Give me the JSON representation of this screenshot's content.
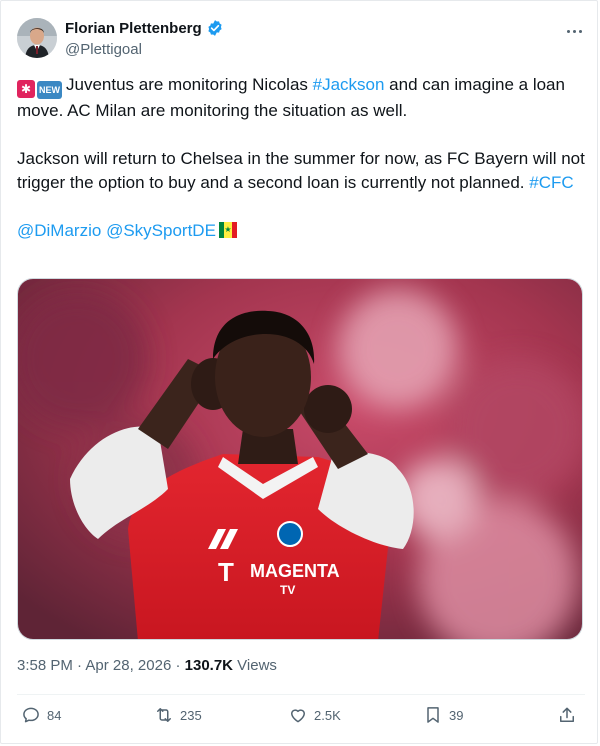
{
  "author": {
    "name": "Florian Plettenberg",
    "handle": "@Plettigoal",
    "verified": true
  },
  "tweet": {
    "line1_prefix": "Juventus are monitoring Nicolas ",
    "hashtag_jackson": "#Jackson",
    "line1_suffix": " and can imagine a loan move. AC Milan are monitoring the situation as well.",
    "para2": "Jackson will return to Chelsea in the summer for now, as FC Bayern will not trigger the option to buy and a second loan is currently not planned. ",
    "hashtag_cfc": "#CFC",
    "mention1": "@DiMarzio",
    "mention2": "@SkySportDE",
    "badge_new": "NEW"
  },
  "media": {
    "shirt_sponsor": "MAGENTA",
    "shirt_sponsor_sub": "TV"
  },
  "meta": {
    "time": "3:58 PM",
    "separator": " · ",
    "date": "Apr 28, 2026",
    "views_count": "130.7K",
    "views_label": " Views"
  },
  "actions": {
    "replies": "84",
    "reposts": "235",
    "likes": "2.5K",
    "bookmarks": "39"
  },
  "colors": {
    "link": "#1d9bf0",
    "muted": "#536471",
    "verified": "#1d9bf0",
    "bayern_red": "#dc052d"
  }
}
